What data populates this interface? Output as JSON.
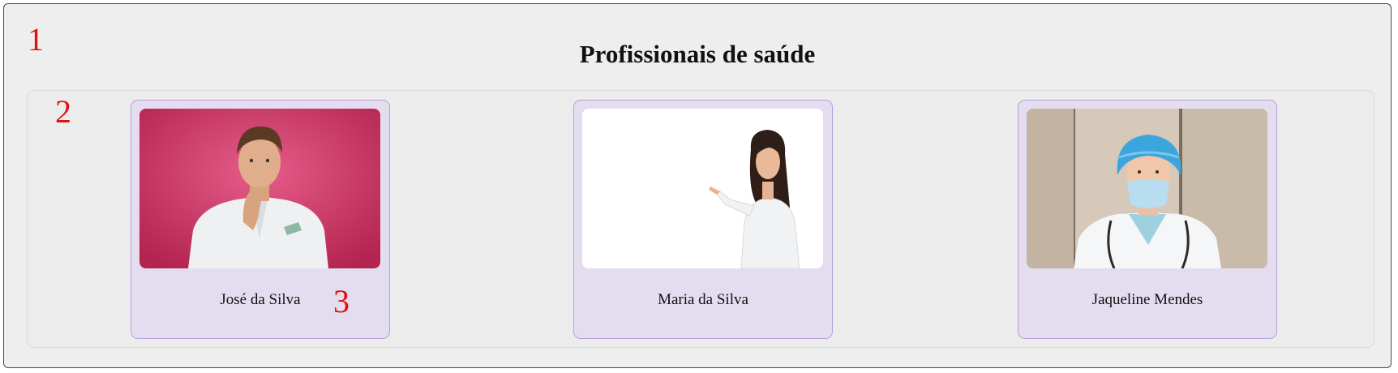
{
  "page": {
    "title": "Profissionais de saúde",
    "annotations": [
      "1",
      "2",
      "3"
    ]
  },
  "professionals": [
    {
      "name": "José da Silva",
      "photo": "man-thinking-pink-background-photo"
    },
    {
      "name": "Maria da Silva",
      "photo": "woman-doctor-pointing-white-background-photo"
    },
    {
      "name": "Jaqueline Mendes",
      "photo": "nurse-mask-hair-cap-photo"
    }
  ],
  "colors": {
    "page_background": "#eeeeee",
    "card_background": "#e4ddef",
    "card_border": "#b7a1dc",
    "annotation": "#e01010"
  }
}
